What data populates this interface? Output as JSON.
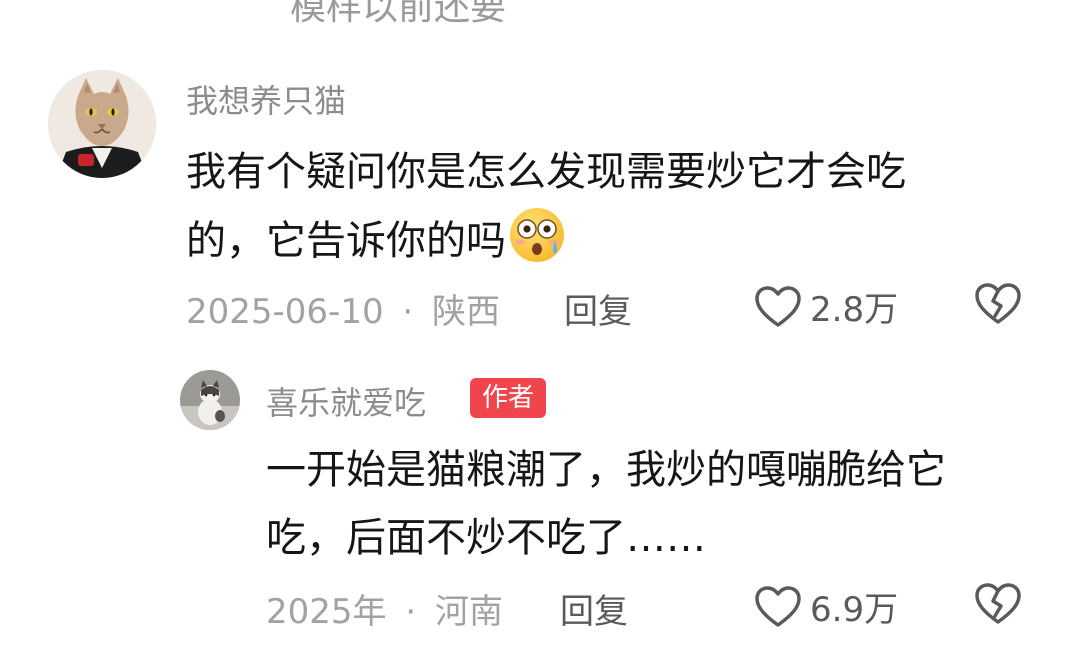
{
  "previous_comment_cutoff": "模样以前还要",
  "comments": [
    {
      "username": "我想养只猫",
      "text_line1": "我有个疑问你是怎么发现需要炒它才会吃",
      "text_line2": "的，它告诉你的吗",
      "emoji": "astonished-emoji",
      "date": "2025-06-10",
      "separator": "·",
      "location": "陕西",
      "reply_label": "回复",
      "likes": "2.8万"
    },
    {
      "username": "喜乐就爱吃",
      "badge": "作者",
      "text_line1": "一开始是猫粮潮了，我炒的嘎嘣脆给它",
      "text_line2": "吃，后面不炒不吃了……",
      "date": "2025年",
      "separator": "·",
      "location": "河南",
      "reply_label": "回复",
      "likes": "6.9万"
    }
  ],
  "colors": {
    "badge_bg": "#f0454c",
    "meta_text": "#a2a2a2",
    "username_text": "#8c8c8c"
  }
}
